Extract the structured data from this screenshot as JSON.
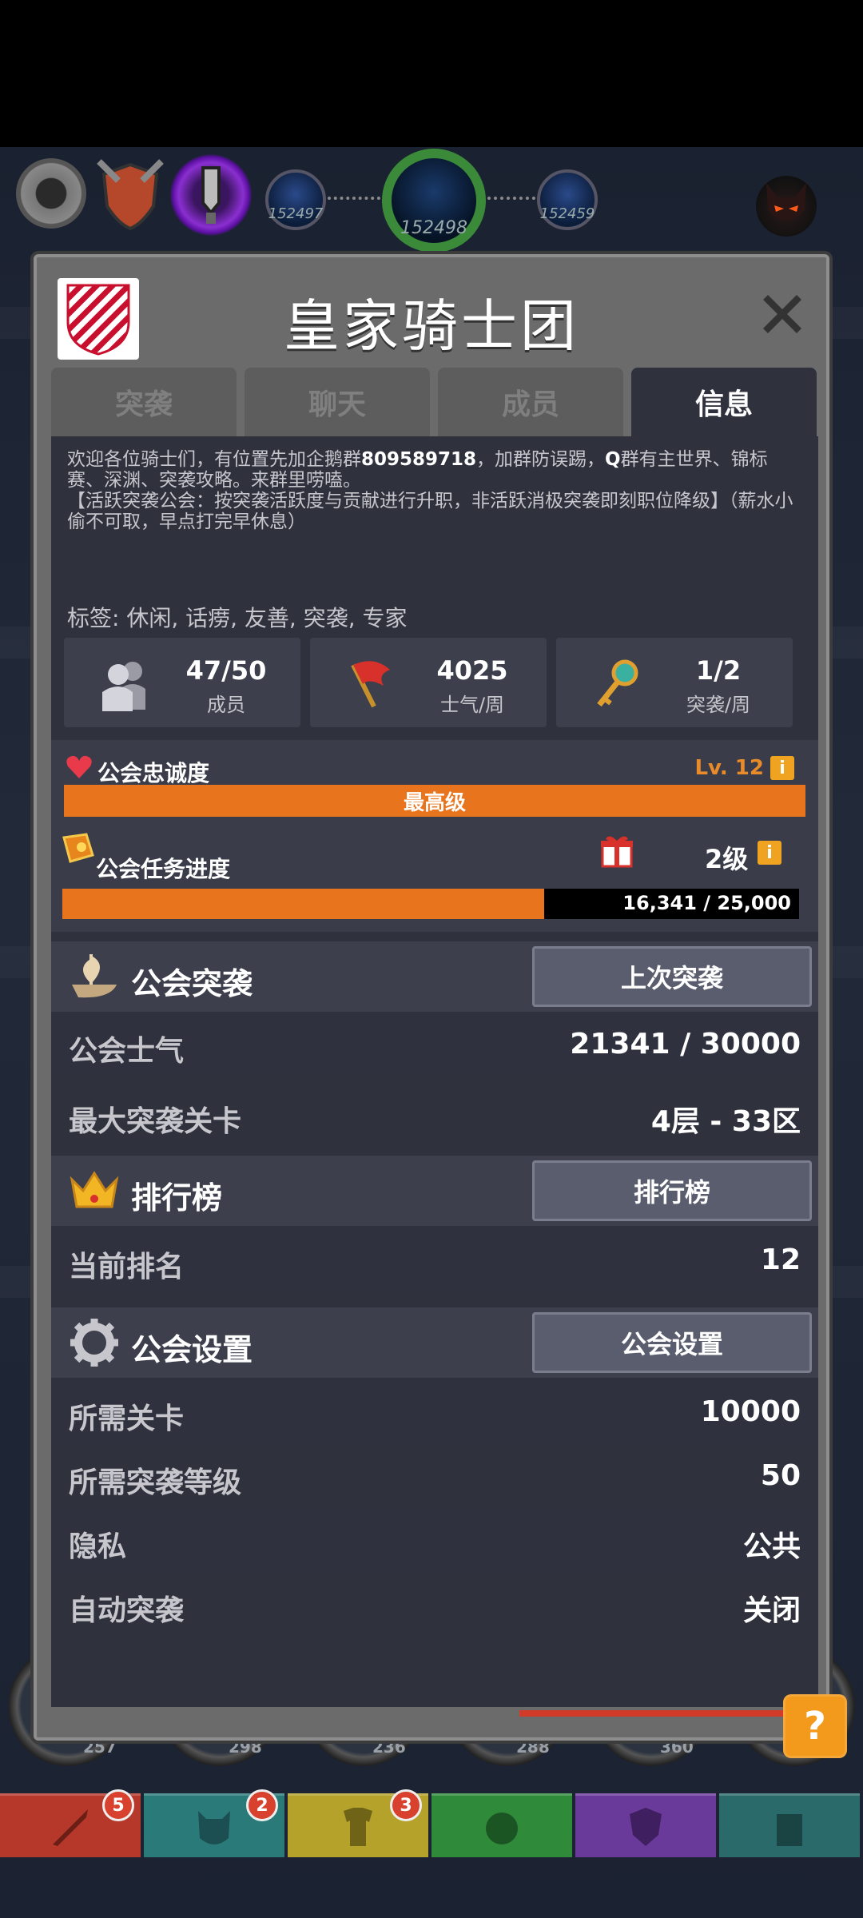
{
  "hud": {
    "orbs": [
      "152497",
      "152498",
      "152459"
    ]
  },
  "modal": {
    "title": "皇家骑士团",
    "tabs": [
      "突袭",
      "聊天",
      "成员",
      "信息"
    ],
    "active_tab": "信息",
    "description_1": "欢迎各位骑士们，有位置先加企鹅群",
    "description_qq": "809589718",
    "description_2": "，加群防误踢，",
    "description_q": "Q",
    "description_3": "群有主世界、锦标赛、深渊、突袭攻略。来群里唠嗑。",
    "description_4": "【活跃突袭公会：按突袭活跃度与贡献进行升职，非活跃消极突袭即刻职位降级】（薪水小偷不可取，早点打完早休息）",
    "tags": "标签: 休闲, 话痨, 友善, 突袭, 专家",
    "stats": [
      {
        "value": "47/50",
        "label": "成员"
      },
      {
        "value": "4025",
        "label": "士气/周"
      },
      {
        "value": "1/2",
        "label": "突袭/周"
      }
    ],
    "loyalty": {
      "label": "公会忠诚度",
      "level": "Lv. 12",
      "bar_text": "最高级"
    },
    "task": {
      "label": "公会任务进度",
      "level": "2级",
      "progress_text": "16,341 / 25,000",
      "progress": 0.654
    },
    "raid": {
      "title": "公会突袭",
      "button": "上次突袭",
      "rows": [
        {
          "k": "公会士气",
          "v": "21341 / 30000"
        },
        {
          "k": "最大突袭关卡",
          "v": "4层 - 33区"
        }
      ]
    },
    "ranking": {
      "title": "排行榜",
      "button": "排行榜",
      "rows": [
        {
          "k": "当前排名",
          "v": "12"
        }
      ]
    },
    "settings": {
      "title": "公会设置",
      "button": "公会设置",
      "rows": [
        {
          "k": "所需关卡",
          "v": "10000"
        },
        {
          "k": "所需突袭等级",
          "v": "50"
        },
        {
          "k": "隐私",
          "v": "公共"
        },
        {
          "k": "自动突袭",
          "v": "关闭"
        }
      ]
    }
  },
  "bottom": {
    "orb_numbers": [
      "257",
      "298",
      "236",
      "288",
      "360"
    ],
    "tab_badges": [
      "5",
      "2",
      "3"
    ],
    "help": "?"
  },
  "colors": {
    "accent": "#e8751e",
    "panel": "#2f323d",
    "frame": "#6b6b6b"
  }
}
